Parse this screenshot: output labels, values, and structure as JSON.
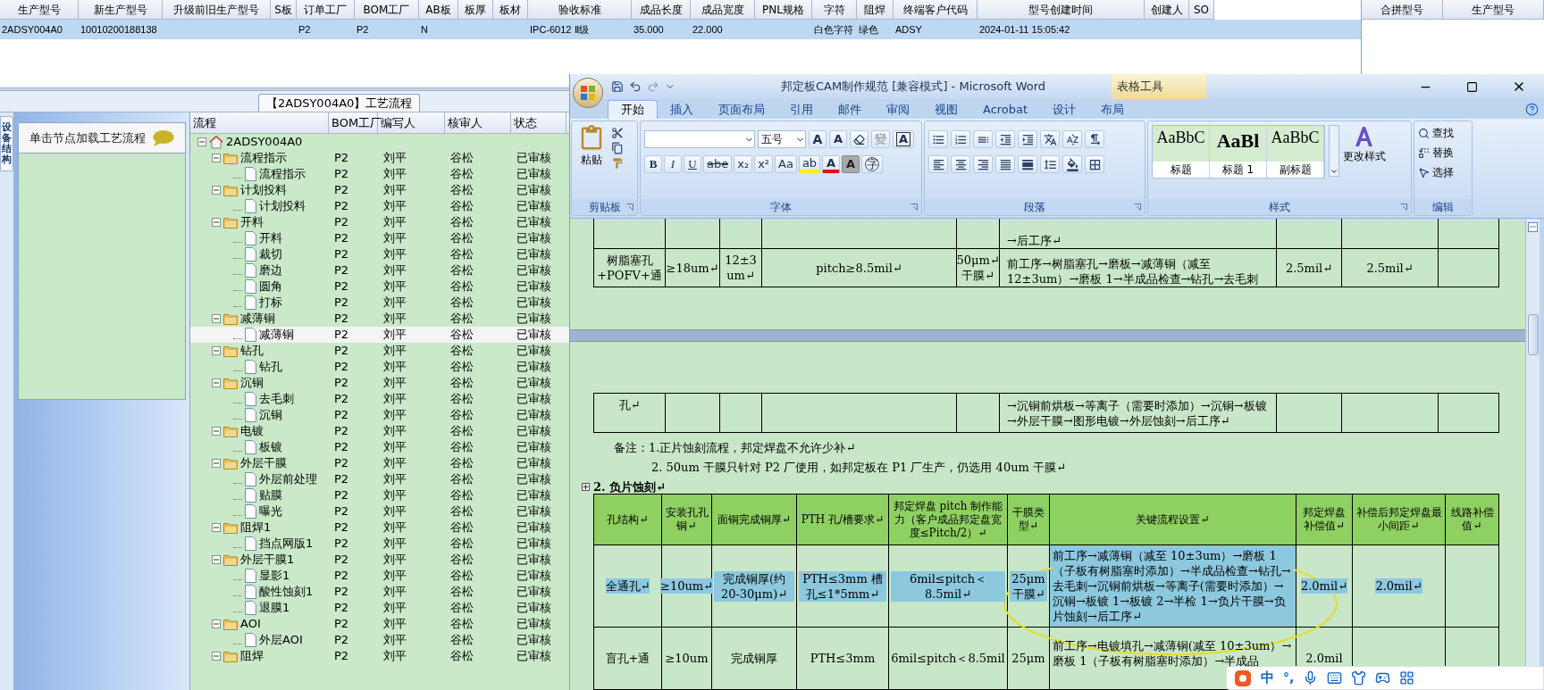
{
  "grid": {
    "row_selected": true,
    "columns": [
      {
        "label": "生产型号",
        "value": "2ADSY004A0"
      },
      {
        "label": "新生产型号",
        "value": "10010200188138"
      },
      {
        "label": "升级前旧生产型号"
      },
      {
        "label": "S板"
      },
      {
        "label": "订单工厂",
        "value": "P2"
      },
      {
        "label": "BOM工厂",
        "value": "P2"
      },
      {
        "label": "AB板",
        "value": "N"
      },
      {
        "label": "板厚"
      },
      {
        "label": "板材"
      },
      {
        "label": "验收标准",
        "value": "IPC-6012 Ⅱ级"
      },
      {
        "label": "成品长度",
        "value": "35.000"
      },
      {
        "label": "成品宽度",
        "value": "22.000"
      },
      {
        "label": "PNL规格"
      },
      {
        "label": "字符",
        "value": "白色字符"
      },
      {
        "label": "阻焊",
        "value": "绿色"
      },
      {
        "label": "终端客户代码",
        "value": "ADSY"
      },
      {
        "label": "型号创建时间",
        "value": "2024-01-11 15:05:42"
      },
      {
        "label": "创建人"
      },
      {
        "label": "SO"
      }
    ]
  },
  "merge_panel": {
    "columns": [
      "合拼型号",
      "生产型号"
    ]
  },
  "process_tab": {
    "title": "【2ADSY004A0】工艺流程"
  },
  "side_tab": {
    "label": "设备结构"
  },
  "left_panel": {
    "hint": "单击节点加载工艺流程"
  },
  "tree": {
    "columns": [
      "流程",
      "BOM工厂",
      "编写人",
      "核审人",
      "状态"
    ],
    "root": {
      "kind": "root",
      "name": "2ADSY004A0",
      "expanded": true,
      "selected": false,
      "children": [
        {
          "kind": "folder",
          "name": "流程指示",
          "bom": "P2",
          "writer": "刘平",
          "reviewer": "谷松",
          "status": "已审核",
          "expanded": true,
          "selected": false,
          "children": [
            {
              "kind": "step",
              "name": "流程指示",
              "bom": "P2",
              "writer": "刘平",
              "reviewer": "谷松",
              "status": "已审核",
              "selected": false
            }
          ]
        },
        {
          "kind": "folder",
          "name": "计划投料",
          "bom": "P2",
          "writer": "刘平",
          "reviewer": "谷松",
          "status": "已审核",
          "expanded": true,
          "selected": false,
          "children": [
            {
              "kind": "step",
              "name": "计划投料",
              "bom": "P2",
              "writer": "刘平",
              "reviewer": "谷松",
              "status": "已审核",
              "selected": false
            }
          ]
        },
        {
          "kind": "folder",
          "name": "开料",
          "bom": "P2",
          "writer": "刘平",
          "reviewer": "谷松",
          "status": "已审核",
          "expanded": true,
          "selected": false,
          "children": [
            {
              "kind": "step",
              "name": "开料",
              "bom": "P2",
              "writer": "刘平",
              "reviewer": "谷松",
              "status": "已审核",
              "selected": false
            },
            {
              "kind": "step",
              "name": "裁切",
              "bom": "P2",
              "writer": "刘平",
              "reviewer": "谷松",
              "status": "已审核",
              "selected": false
            },
            {
              "kind": "step",
              "name": "磨边",
              "bom": "P2",
              "writer": "刘平",
              "reviewer": "谷松",
              "status": "已审核",
              "selected": false
            },
            {
              "kind": "step",
              "name": "圆角",
              "bom": "P2",
              "writer": "刘平",
              "reviewer": "谷松",
              "status": "已审核",
              "selected": false
            },
            {
              "kind": "step",
              "name": "打标",
              "bom": "P2",
              "writer": "刘平",
              "reviewer": "谷松",
              "status": "已审核",
              "selected": false
            }
          ]
        },
        {
          "kind": "folder",
          "name": "减薄铜",
          "bom": "P2",
          "writer": "刘平",
          "reviewer": "谷松",
          "status": "已审核",
          "expanded": true,
          "selected": false,
          "children": [
            {
              "kind": "step",
              "name": "减薄铜",
              "bom": "P2",
              "writer": "刘平",
              "reviewer": "谷松",
              "status": "已审核",
              "selected": true
            }
          ]
        },
        {
          "kind": "folder",
          "name": "钻孔",
          "bom": "P2",
          "writer": "刘平",
          "reviewer": "谷松",
          "status": "已审核",
          "expanded": true,
          "selected": false,
          "children": [
            {
              "kind": "step",
              "name": "钻孔",
              "bom": "P2",
              "writer": "刘平",
              "reviewer": "谷松",
              "status": "已审核",
              "selected": false
            }
          ]
        },
        {
          "kind": "folder",
          "name": "沉铜",
          "bom": "P2",
          "writer": "刘平",
          "reviewer": "谷松",
          "status": "已审核",
          "expanded": true,
          "selected": false,
          "children": [
            {
              "kind": "step",
              "name": "去毛刺",
              "bom": "P2",
              "writer": "刘平",
              "reviewer": "谷松",
              "status": "已审核",
              "selected": false
            },
            {
              "kind": "step",
              "name": "沉铜",
              "bom": "P2",
              "writer": "刘平",
              "reviewer": "谷松",
              "status": "已审核",
              "selected": false
            }
          ]
        },
        {
          "kind": "folder",
          "name": "电镀",
          "bom": "P2",
          "writer": "刘平",
          "reviewer": "谷松",
          "status": "已审核",
          "expanded": true,
          "selected": false,
          "children": [
            {
              "kind": "step",
              "name": "板镀",
              "bom": "P2",
              "writer": "刘平",
              "reviewer": "谷松",
              "status": "已审核",
              "selected": false
            }
          ]
        },
        {
          "kind": "folder",
          "name": "外层干膜",
          "bom": "P2",
          "writer": "刘平",
          "reviewer": "谷松",
          "status": "已审核",
          "expanded": true,
          "selected": false,
          "children": [
            {
              "kind": "step",
              "name": "外层前处理",
              "bom": "P2",
              "writer": "刘平",
              "reviewer": "谷松",
              "status": "已审核",
              "selected": false
            },
            {
              "kind": "step",
              "name": "贴膜",
              "bom": "P2",
              "writer": "刘平",
              "reviewer": "谷松",
              "status": "已审核",
              "selected": false
            },
            {
              "kind": "step",
              "name": "曝光",
              "bom": "P2",
              "writer": "刘平",
              "reviewer": "谷松",
              "status": "已审核",
              "selected": false
            }
          ]
        },
        {
          "kind": "folder",
          "name": "阻焊1",
          "bom": "P2",
          "writer": "刘平",
          "reviewer": "谷松",
          "status": "已审核",
          "expanded": true,
          "selected": false,
          "children": [
            {
              "kind": "step",
              "name": "挡点网版1",
              "bom": "P2",
              "writer": "刘平",
              "reviewer": "谷松",
              "status": "已审核",
              "selected": false
            }
          ]
        },
        {
          "kind": "folder",
          "name": "外层干膜1",
          "bom": "P2",
          "writer": "刘平",
          "reviewer": "谷松",
          "status": "已审核",
          "expanded": true,
          "selected": false,
          "children": [
            {
              "kind": "step",
              "name": "显影1",
              "bom": "P2",
              "writer": "刘平",
              "reviewer": "谷松",
              "status": "已审核",
              "selected": false
            },
            {
              "kind": "step",
              "name": "酸性蚀刻1",
              "bom": "P2",
              "writer": "刘平",
              "reviewer": "谷松",
              "status": "已审核",
              "selected": false
            },
            {
              "kind": "step",
              "name": "退膜1",
              "bom": "P2",
              "writer": "刘平",
              "reviewer": "谷松",
              "status": "已审核",
              "selected": false
            }
          ]
        },
        {
          "kind": "folder",
          "name": "AOI",
          "bom": "P2",
          "writer": "刘平",
          "reviewer": "谷松",
          "status": "已审核",
          "expanded": true,
          "selected": false,
          "children": [
            {
              "kind": "step",
              "name": "外层AOI",
              "bom": "P2",
              "writer": "刘平",
              "reviewer": "谷松",
              "status": "已审核",
              "selected": false
            }
          ]
        },
        {
          "kind": "folder",
          "name": "阻焊",
          "bom": "P2",
          "writer": "刘平",
          "reviewer": "谷松",
          "status": "已审核",
          "expanded": true,
          "selected": false
        }
      ]
    }
  },
  "word": {
    "title": "邦定板CAM制作规范 [兼容模式] - Microsoft Word",
    "context_tab": "表格工具",
    "tabs": [
      {
        "label": "开始",
        "selected": true
      },
      {
        "label": "插入",
        "selected": false
      },
      {
        "label": "页面布局",
        "selected": false
      },
      {
        "label": "引用",
        "selected": false
      },
      {
        "label": "邮件",
        "selected": false
      },
      {
        "label": "审阅",
        "selected": false
      },
      {
        "label": "视图",
        "selected": false
      },
      {
        "label": "Acrobat",
        "selected": false
      },
      {
        "label": "设计",
        "selected": false
      },
      {
        "label": "布局",
        "selected": false
      }
    ],
    "clipboard": {
      "paste": "粘贴",
      "group": "剪贴板"
    },
    "font": {
      "group": "字体",
      "size": "五号",
      "top_buttons": [
        {
          "kind": "grow",
          "text": "A"
        },
        {
          "kind": "shrink",
          "text": "A"
        },
        {
          "kind": "clear"
        },
        {
          "kind": "phonetic",
          "text": "變"
        },
        {
          "kind": "border",
          "text": "A"
        }
      ],
      "bottom_buttons": [
        {
          "kind": "bold",
          "text": "B"
        },
        {
          "kind": "italic",
          "text": "I"
        },
        {
          "kind": "underline",
          "text": "U"
        },
        {
          "kind": "strike",
          "text": "abe"
        },
        {
          "kind": "plain",
          "text": "x₂"
        },
        {
          "kind": "plain",
          "text": "x²"
        },
        {
          "kind": "plain",
          "text": "Aa"
        },
        {
          "kind": "highlight",
          "text": "ab"
        },
        {
          "kind": "color",
          "text": "A"
        },
        {
          "kind": "shade",
          "text": "A"
        },
        {
          "kind": "enclose",
          "text": "字"
        }
      ]
    },
    "paragraph": {
      "group": "段落"
    },
    "styles": {
      "group": "样式",
      "items": [
        {
          "sample": "AaBbC",
          "label": "标题"
        },
        {
          "sample": "AaBl",
          "label": "标题 1"
        },
        {
          "sample": "AaBbC",
          "label": "副标题"
        }
      ],
      "change": "更改样式"
    },
    "editing": {
      "group": "编辑",
      "items": [
        "查找",
        "替换",
        "选择"
      ]
    },
    "doc": {
      "table_1_rows": [
        {
          "column_6": "→后工序↵"
        },
        {
          "column_1": "树脂塞孔+POFV+通",
          "column_2": "≥18um↵",
          "column_3": "12±3 um↵",
          "column_4": "pitch≥8.5mil↵",
          "column_5": "50μm↵ 干膜↵",
          "column_6": "前工序→树脂塞孔→磨板→减薄铜（减至12±3um）→磨板 1→半成品检查→钻孔→去毛刺",
          "column_7": "2.5mil↵",
          "column_8": "2.5mil↵"
        },
        {
          "column_1": "孔↵",
          "column_6": "→沉铜前烘板→等离子（需要时添加）→沉铜→板镀→外层干膜→图形电镀→外层蚀刻→后工序↵"
        }
      ],
      "notes": [
        "备注：1.正片蚀刻流程，邦定焊盘不允许少补↵",
        "2. 50um 干膜只针对 P2 厂使用，如邦定板在 P1 厂生产，仍选用 40um 干膜↵"
      ],
      "heading": "2.  负片蚀刻↵",
      "table_2_header": [
        "孔结构↵",
        "安装孔孔铜↵",
        "面铜完成铜厚↵",
        "PTH 孔/槽要求↵",
        "邦定焊盘 pitch 制作能力（客户成品邦定盘宽度≤Pitch/2）↵",
        "干膜类型↵",
        "关键流程设置↵",
        "邦定焊盘补偿值↵",
        "补偿后邦定焊盘最小间距↵",
        "线路补偿值↵"
      ],
      "table_2_rows": [
        {
          "selected": true,
          "cells": [
            "全通孔↵",
            "≥10um↵",
            "完成铜厚(约 20-30μm)↵",
            "PTH≤3mm 槽孔≤1*5mm↵",
            "6mil≤pitch＜8.5mil↵",
            "25μm 干膜↵",
            "前工序→减薄铜（减至 10±3um）→磨板 1（子板有树脂塞时添加）→半成品检查→钻孔→去毛刺→沉铜前烘板→等离子(需要时添加）→沉铜→板镀 1→板镀 2→半检 1→负片干膜→负片蚀刻→后工序↵",
            "2.0mil↵",
            "2.0mil↵"
          ]
        },
        {
          "selected": false,
          "cells": [
            "盲孔+通",
            "≥10um",
            "完成铜厚",
            "PTH≤3mm",
            "6mil≤pitch＜8.5mil",
            "25μm",
            "前工序→电镀填孔→减薄铜(减至 10±3um）→磨板 1（子板有树脂塞时添加）→半成品",
            "2.0mil"
          ]
        }
      ]
    }
  },
  "ime": {
    "mode": "中",
    "punct": "°,"
  }
}
